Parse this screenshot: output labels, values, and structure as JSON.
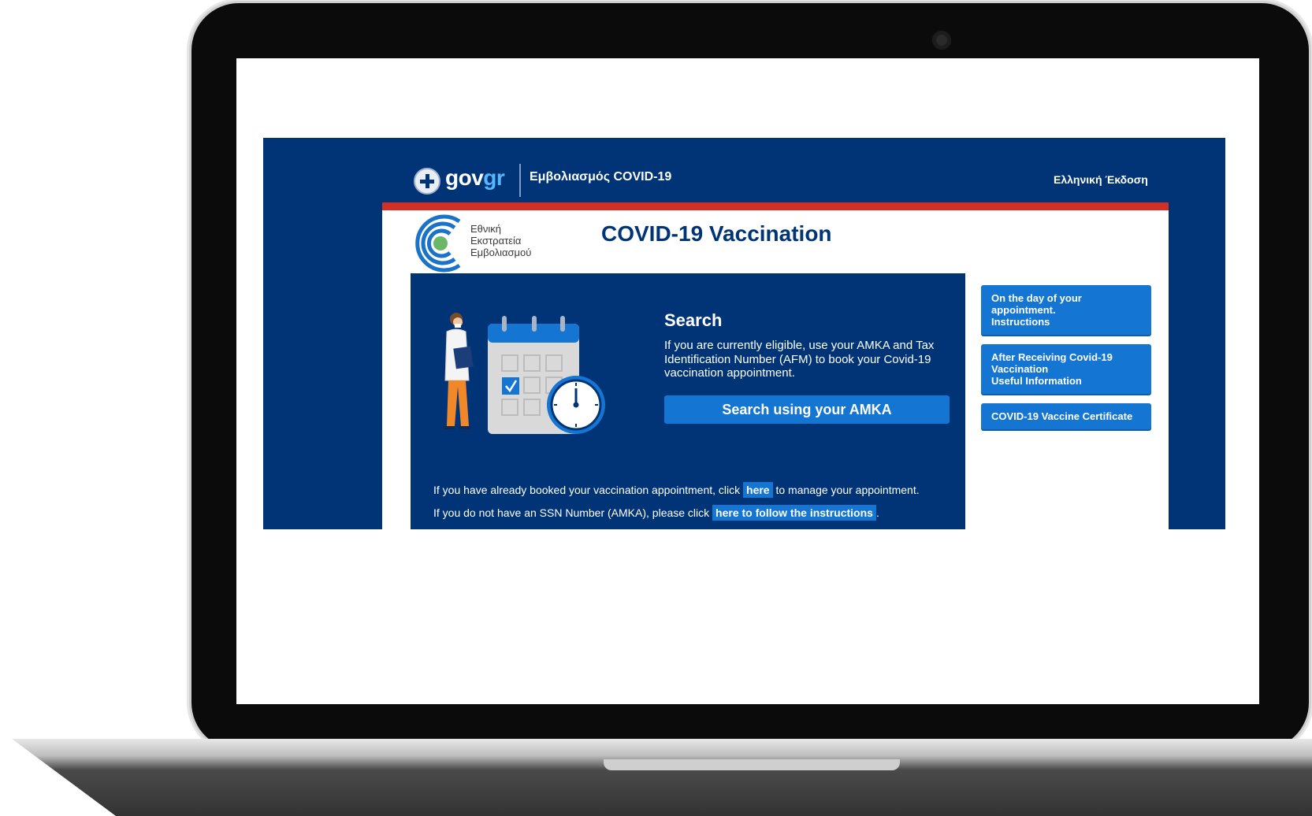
{
  "site": {
    "header": {
      "brand_gov": "gov",
      "brand_gr": "gr",
      "service_title": "Εμβολιασμός COVID-19",
      "language_link": "Ελληνική Έκδοση"
    },
    "campaign_logo": {
      "lines": [
        "Εθνική",
        "Εκστρατεία",
        "Εμβολιασμού"
      ]
    },
    "page_title": "COVID-19 Vaccination",
    "search_card": {
      "title": "Search",
      "description": "If you are currently eligible, use your AMKA and Tax Identification Number (AFM) to book your Covid-19 vaccination appointment.",
      "button_label": "Search using your AMKA",
      "note1_before": "If you have already booked your vaccination appointment, click ",
      "note1_link": "here",
      "note1_after": " to manage your appointment.",
      "note2_before": "If you do not have an SSN Number (AMKA), please click ",
      "note2_link": "here to follow the instructions",
      "note2_after": "."
    },
    "side_links": [
      {
        "lines": [
          "On the day of your",
          "appointment.",
          "Instructions"
        ]
      },
      {
        "lines": [
          "After Receiving Covid-19",
          "Vaccination",
          "Useful Information"
        ]
      },
      {
        "lines": [
          "COVID-19 Vaccine Certificate"
        ]
      }
    ],
    "colors": {
      "navy": "#003476",
      "accent_blue": "#1476d2",
      "header_red": "#d42f26",
      "govgr_blue": "#55b7ff"
    },
    "icons": [
      "greek-emblem-icon",
      "calendar-icon",
      "clock-icon",
      "doctor-illustration-icon",
      "checkmark-icon"
    ]
  }
}
